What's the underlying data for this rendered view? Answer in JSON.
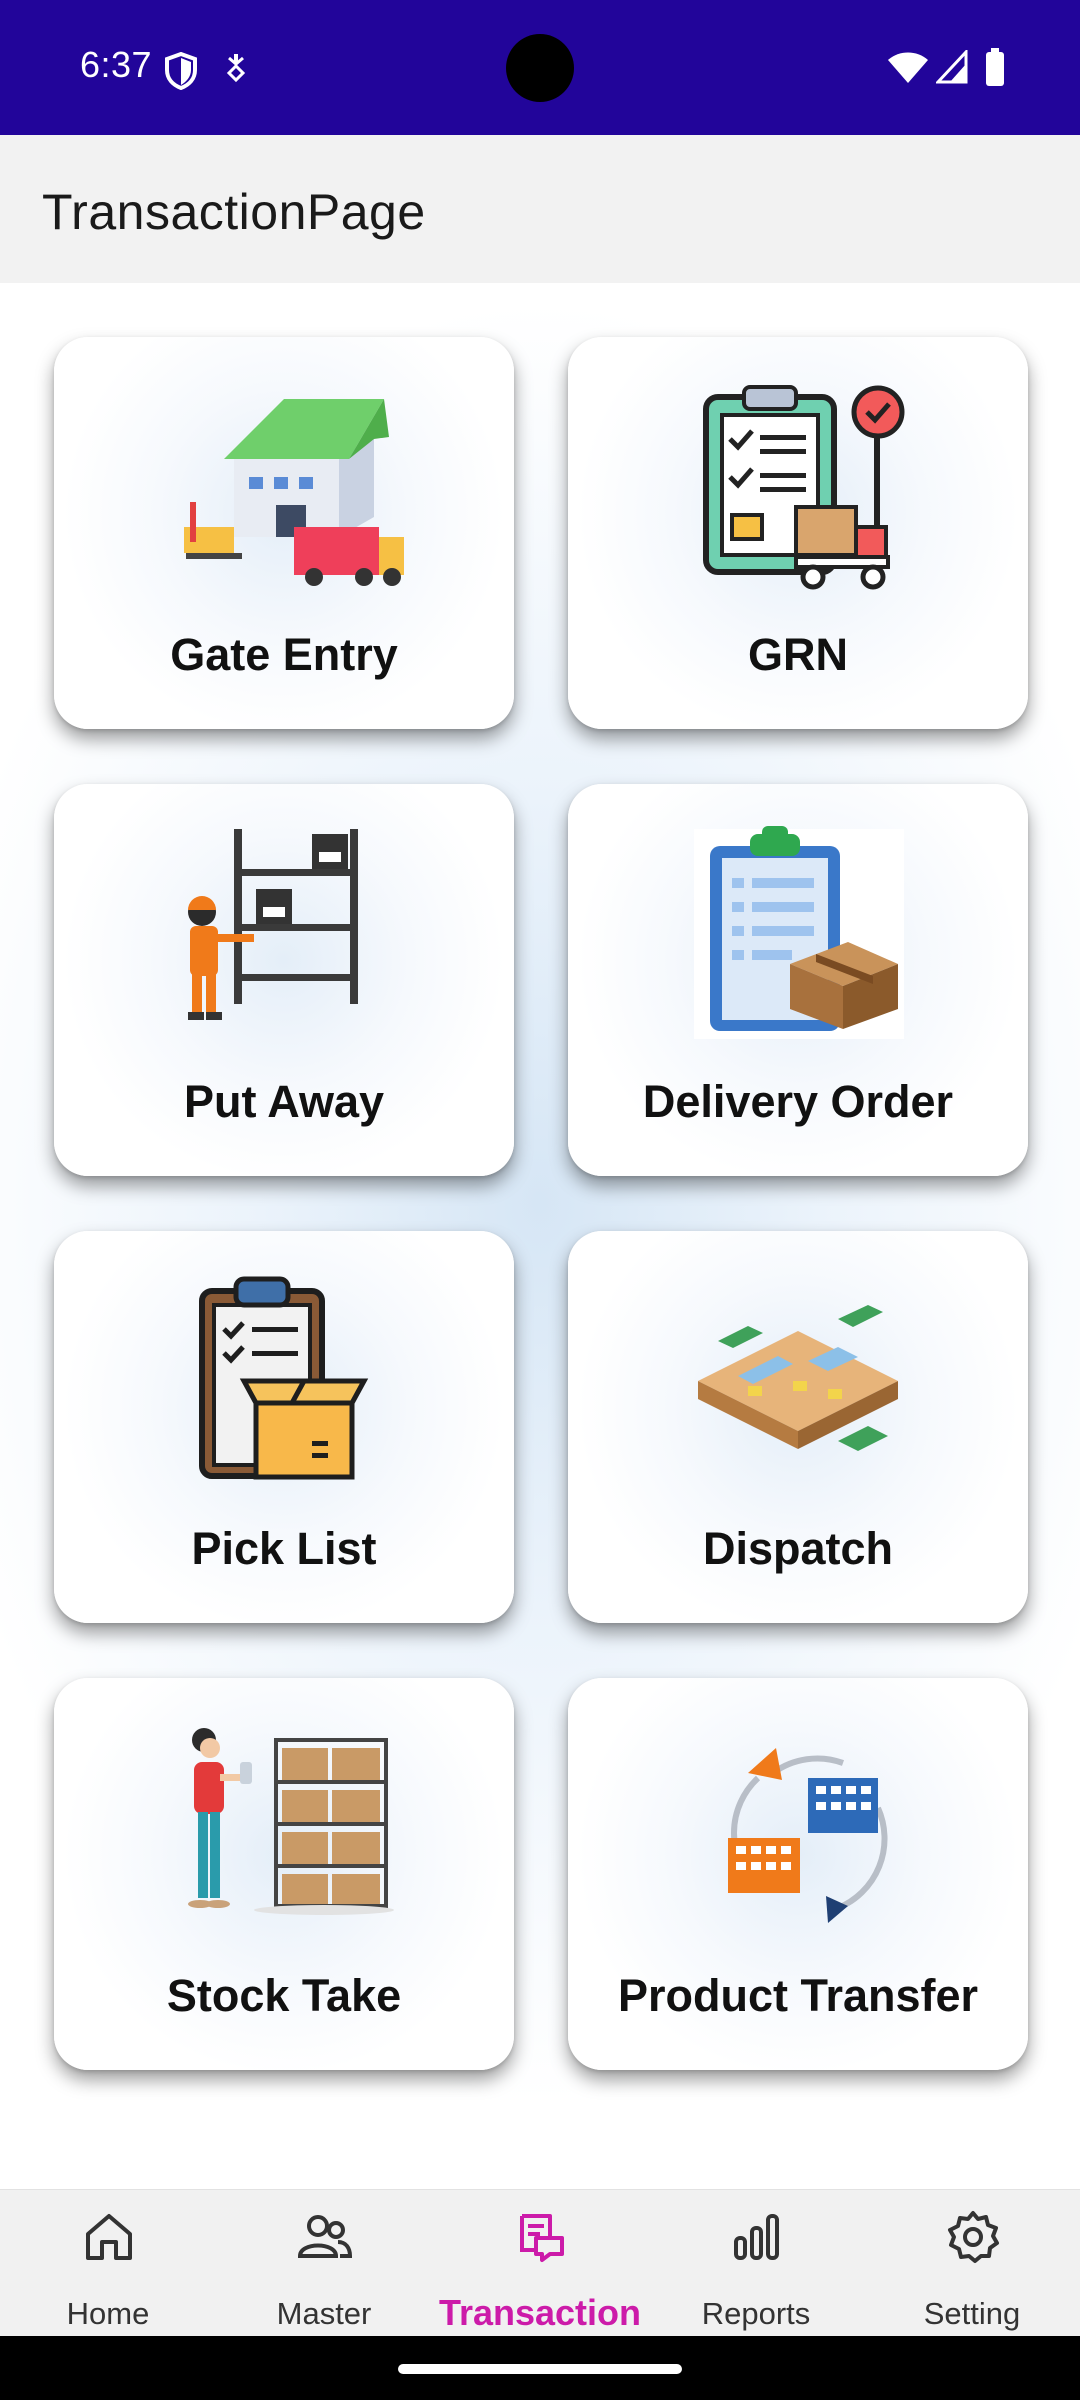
{
  "status_bar": {
    "time": "6:37",
    "icons": [
      "shield-icon",
      "hotspot-icon",
      "wifi-icon",
      "signal-icon",
      "battery-icon"
    ],
    "background": "#22059a"
  },
  "app_bar": {
    "title": "TransactionPage",
    "background": "#f2f2f2"
  },
  "tiles": [
    {
      "label": "Gate Entry",
      "icon": "warehouse-truck-icon"
    },
    {
      "label": "GRN",
      "icon": "clipboard-checklist-icon"
    },
    {
      "label": "Put Away",
      "icon": "worker-shelf-icon"
    },
    {
      "label": "Delivery Order",
      "icon": "order-clipboard-box-icon"
    },
    {
      "label": "Pick List",
      "icon": "picklist-clipboard-box-icon"
    },
    {
      "label": "Dispatch",
      "icon": "dispatch-warehouse-icon"
    },
    {
      "label": "Stock Take",
      "icon": "stock-take-person-shelf-icon"
    },
    {
      "label": "Product Transfer",
      "icon": "buildings-transfer-icon"
    }
  ],
  "bottom_nav": {
    "active_color": "#cc1ba9",
    "items": [
      {
        "label": "Home",
        "icon": "home-icon",
        "active": false
      },
      {
        "label": "Master",
        "icon": "users-icon",
        "active": false
      },
      {
        "label": "Transaction",
        "icon": "transaction-icon",
        "active": true
      },
      {
        "label": "Reports",
        "icon": "bar-chart-icon",
        "active": false
      },
      {
        "label": "Setting",
        "icon": "gear-icon",
        "active": false
      }
    ]
  }
}
